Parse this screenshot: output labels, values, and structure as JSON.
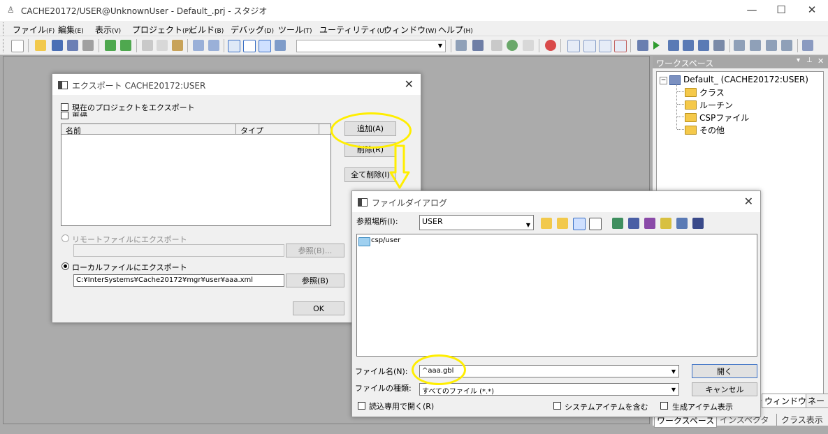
{
  "window": {
    "title": "CACHE20172/USER@UnknownUser - Default_.prj - スタジオ"
  },
  "menu": [
    {
      "label": "ファイル",
      "acc": "(F)"
    },
    {
      "label": "編集",
      "acc": "(E)"
    },
    {
      "label": "表示",
      "acc": "(V)"
    },
    {
      "label": "プロジェクト",
      "acc": "(P)"
    },
    {
      "label": "ビルド",
      "acc": "(B)"
    },
    {
      "label": "デバッグ",
      "acc": "(D)"
    },
    {
      "label": "ツール",
      "acc": "(T)"
    },
    {
      "label": "ユーティリティ",
      "acc": "(U)"
    },
    {
      "label": "ウィンドウ",
      "acc": "(W)"
    },
    {
      "label": "ヘルプ",
      "acc": "(H)"
    }
  ],
  "workspace": {
    "title": "ワークスペース",
    "root": "Default_ (CACHE20172:USER)",
    "children": [
      "クラス",
      "ルーチン",
      "CSPファイル",
      "その他"
    ],
    "tabs_bottom": [
      "ワークスペース",
      "インスペクタ",
      "クラス表示"
    ],
    "tabs_side": [
      "ウィンドウ",
      "ネー"
    ]
  },
  "export_dialog": {
    "title": "エクスポート CACHE20172:USER",
    "checkbox_project": "現在のプロジェクトをエクスポート",
    "checkbox_recursive": "再帰",
    "col_name": "名前",
    "col_type": "タイプ",
    "btn_add": "追加(A)",
    "btn_delete": "削除(R)",
    "btn_delete_all": "全て削除(I)",
    "radio_remote": "リモートファイルにエクスポート",
    "btn_browse_remote": "参照(B)...",
    "radio_local": "ローカルファイルにエクスポート",
    "local_path": "C:¥InterSystems¥Cache20172¥mgr¥user¥aaa.xml",
    "btn_browse_local": "参照(B)",
    "btn_ok": "OK"
  },
  "file_dialog": {
    "title": "ファイルダイアログ",
    "lookin_label": "参照場所(I):",
    "lookin_value": "USER",
    "files": [
      "csp/user"
    ],
    "filename_label": "ファイル名(N):",
    "filename_value": "^aaa.gbl",
    "filetype_label": "ファイルの種類:",
    "filetype_value": "すべてのファイル (*.*)",
    "btn_open": "開く",
    "btn_cancel": "キャンセル",
    "chk_readonly": "読込専用で開く(R)",
    "chk_system": "システムアイテムを含む",
    "chk_generated": "生成アイテム表示"
  }
}
